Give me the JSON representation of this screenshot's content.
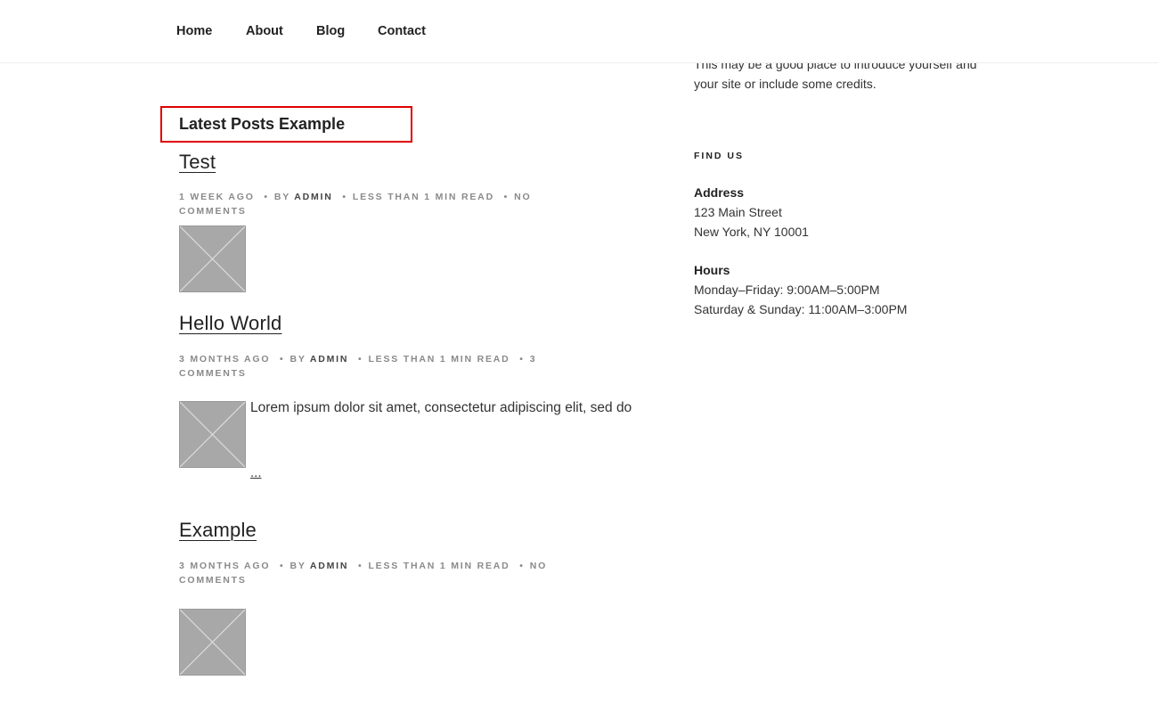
{
  "nav": {
    "items": [
      {
        "label": "Home"
      },
      {
        "label": "About"
      },
      {
        "label": "Blog"
      },
      {
        "label": "Contact"
      }
    ]
  },
  "sidebar": {
    "intro": "This may be a good place to introduce yourself and your site or include some credits.",
    "find_us_title": "FIND US",
    "address_heading": "Address",
    "address_line1": "123 Main Street",
    "address_line2": "New York, NY 10001",
    "hours_heading": "Hours",
    "hours_line1": "Monday–Friday: 9:00AM–5:00PM",
    "hours_line2": "Saturday & Sunday: 11:00AM–3:00PM"
  },
  "section": {
    "title": "Latest Posts Example"
  },
  "posts": [
    {
      "title": "Test",
      "date": "1 week ago",
      "by": "by",
      "author": "admin",
      "read": "Less than 1 min read",
      "comments": "No Comments"
    },
    {
      "title": "Hello World",
      "date": "3 months ago",
      "by": "by",
      "author": "admin",
      "read": "Less than 1 min read",
      "comments": "3 Comments",
      "excerpt": "Lorem ipsum dolor sit amet, consectetur adipiscing elit, sed do",
      "more": "..."
    },
    {
      "title": "Example",
      "date": "3 months ago",
      "by": "by",
      "author": "admin",
      "read": "Less than 1 min read",
      "comments": "No Comments"
    }
  ],
  "colors": {
    "highlight_border": "#e00000",
    "meta_text": "#8a8a8a",
    "thumb_bg": "#a8a8a8"
  }
}
